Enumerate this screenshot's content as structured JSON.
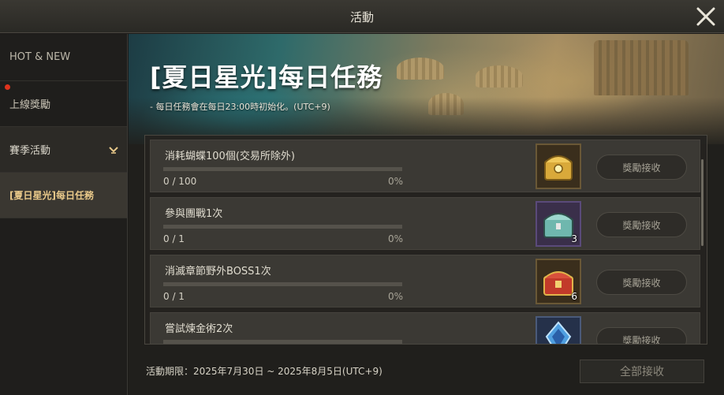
{
  "window": {
    "title": "活動"
  },
  "sidebar": {
    "items": [
      {
        "label": "HOT & NEW"
      },
      {
        "label": "上線獎勵"
      },
      {
        "label": "賽季活動"
      },
      {
        "label": "[夏日星光]每日任務"
      }
    ]
  },
  "event": {
    "title": "[夏日星光]每日任務",
    "note": "- 每日任務會在每日23:00時初始化。(UTC+9)"
  },
  "missions": [
    {
      "name": "消耗蝴蝶100個(交易所除外)",
      "count": "0 / 100",
      "percent": "0%",
      "progress": 0,
      "reward_icon": "gold-chest-icon",
      "reward_qty": "",
      "claim_label": "獎勵接收"
    },
    {
      "name": "參與團戰1次",
      "count": "0 / 1",
      "percent": "0%",
      "progress": 0,
      "reward_icon": "teal-chest-icon",
      "reward_qty": "3",
      "claim_label": "獎勵接收"
    },
    {
      "name": "消滅章節野外BOSS1次",
      "count": "0 / 1",
      "percent": "0%",
      "progress": 0,
      "reward_icon": "red-chest-icon",
      "reward_qty": "6",
      "claim_label": "獎勵接收"
    },
    {
      "name": "嘗試煉金術2次",
      "count": "",
      "percent": "",
      "progress": 0,
      "reward_icon": "blue-crystal-icon",
      "reward_qty": "",
      "claim_label": "獎勵接收"
    }
  ],
  "footer": {
    "period": "活動期限：2025年7月30日 ~ 2025年8月5日(UTC+9)",
    "claim_all_label": "全部接收"
  },
  "colors": {
    "accent": "#e9c98a",
    "notification": "#e0331d"
  }
}
